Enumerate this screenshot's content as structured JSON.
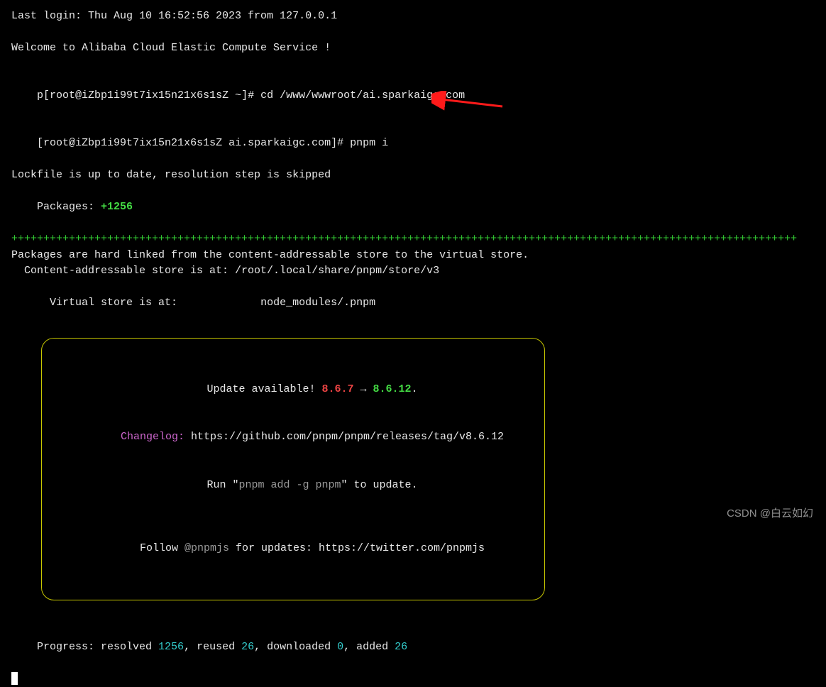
{
  "login_line": "Last login: Thu Aug 10 16:52:56 2023 from 127.0.0.1",
  "welcome_line": "Welcome to Alibaba Cloud Elastic Compute Service !",
  "prompt1": {
    "prefix": "p[",
    "userhost": "root@iZbp1i99t7ix15n21x6s1sZ",
    "dir": " ~",
    "suffix": "]# ",
    "cmd_cd": "cd ",
    "path": "/www/wwwroot/ai.sparkaigc.com"
  },
  "prompt2": {
    "prefix": "[",
    "userhost": "root@iZbp1i99t7ix15n21x6s1sZ",
    "dir": " ai.sparkaigc.com",
    "suffix": "]# ",
    "cmd": "pnpm i"
  },
  "lockfile_line": "Lockfile is up to date, resolution step is skipped",
  "packages_label": "Packages: ",
  "packages_count": "+1256",
  "plusbar": "+++++++++++++++++++++++++++++++++++++++++++++++++++++++++++++++++++++++++++++++++++++++++++++++++++++++++++++++++++++++++++",
  "hardlink_line": "Packages are hard linked from the content-addressable store to the virtual store.",
  "cas_line": "  Content-addressable store is at: /root/.local/share/pnpm/store/v3",
  "virtual_line_label": "  Virtual store is at:             ",
  "virtual_line_path": "node_modules/.pnpm",
  "box": {
    "update_prefix": "Update available! ",
    "old_ver": "8.6.7",
    "arrow": " → ",
    "new_ver": "8.6.12",
    "dot": ".",
    "changelog_label": "Changelog: ",
    "changelog_url": "https://github.com/pnpm/pnpm/releases/tag/v8.6.12",
    "run_prefix": "Run \"",
    "run_cmd": "pnpm add -g pnpm",
    "run_suffix": "\" to update.",
    "follow_prefix": "Follow ",
    "follow_handle": "@pnpmjs",
    "follow_mid": " for updates: ",
    "follow_url": "https://twitter.com/pnpmjs"
  },
  "progress": {
    "label": "Progress: ",
    "resolved_lbl": "resolved ",
    "resolved_n": "1256",
    "reused_lbl": ", reused ",
    "reused_n": "26",
    "downloaded_lbl": ", downloaded ",
    "downloaded_n": "0",
    "added_lbl": ", added ",
    "added_n": "26"
  },
  "watermark": "CSDN @白云如幻"
}
